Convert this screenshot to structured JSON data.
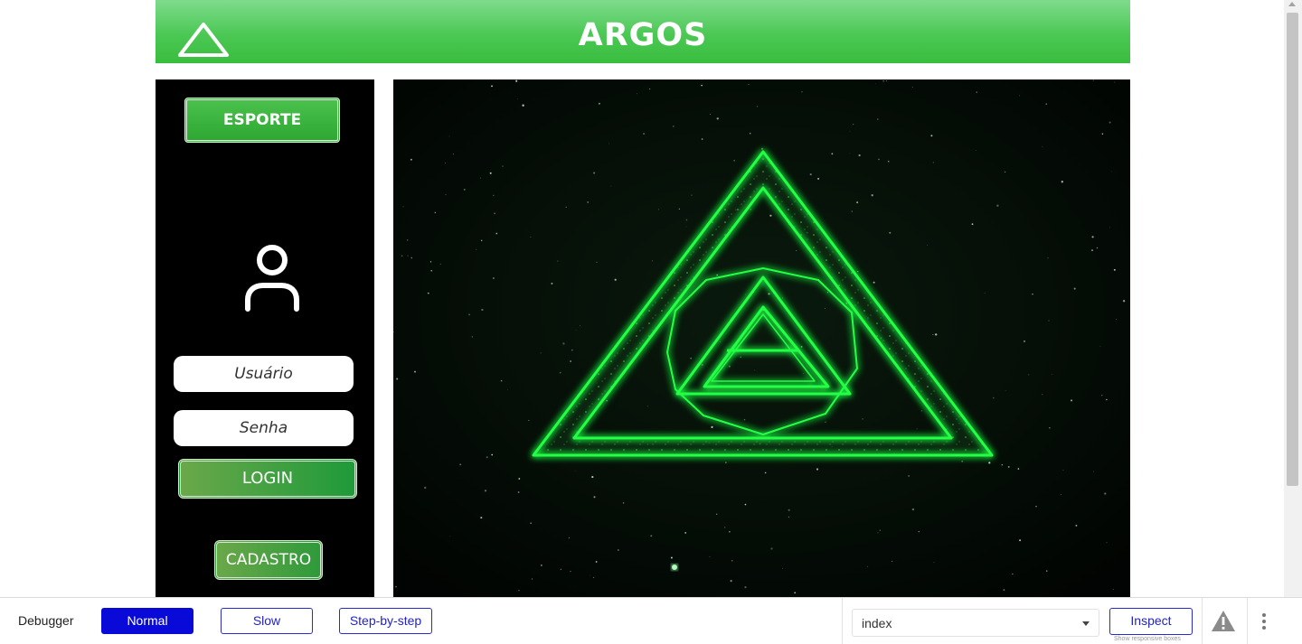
{
  "header": {
    "title": "ARGOS",
    "logo_icon": "triangle-outline-icon"
  },
  "sidebar": {
    "sport_button": "ESPORTE",
    "avatar_icon": "user-icon",
    "username_placeholder": "Usuário",
    "password_placeholder": "Senha",
    "login_button": "LOGIN",
    "signup_button": "CADASTRO"
  },
  "hero": {
    "image_icon": "neon-triangle-logo"
  },
  "debugger": {
    "label": "Debugger",
    "modes": [
      "Normal",
      "Slow",
      "Step-by-step"
    ],
    "active_mode": "Normal",
    "page_select_value": "index",
    "inspect_button": "Inspect",
    "responsive_note": "Show responsive boxes",
    "warning_icon": "warning-icon",
    "more_icon": "more-vertical-icon"
  },
  "colors": {
    "header_green": "#4bc854",
    "neon_green": "#22ff44",
    "sidebar_bg": "#000000",
    "debugger_accent": "#0a0ad8"
  }
}
